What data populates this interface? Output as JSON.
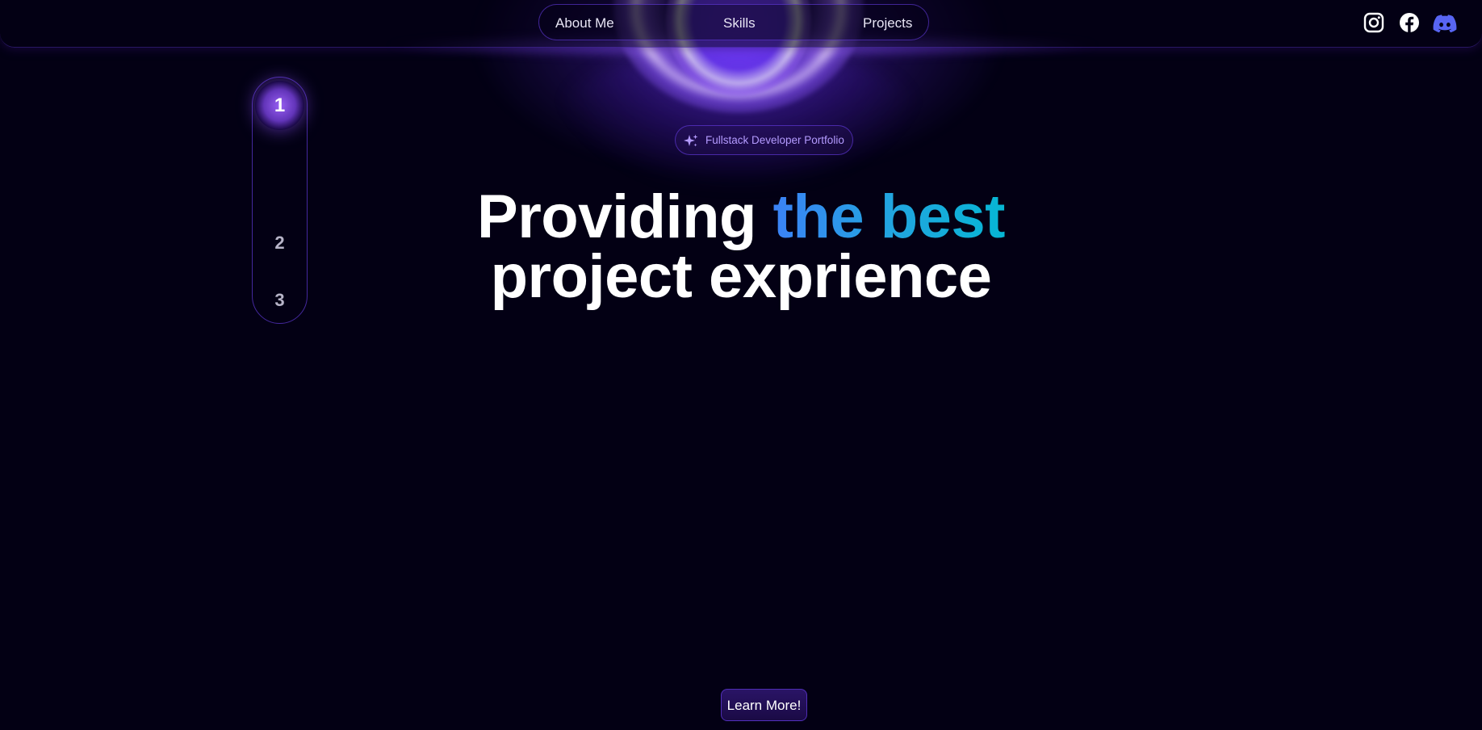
{
  "nav": {
    "links": [
      {
        "label": "About Me"
      },
      {
        "label": "Skills"
      },
      {
        "label": "Projects"
      }
    ]
  },
  "social": [
    {
      "icon": "instagram-icon"
    },
    {
      "icon": "facebook-icon"
    },
    {
      "icon": "discord-icon",
      "color": "#5865F2"
    }
  ],
  "stepper": {
    "steps": [
      "1",
      "2",
      "3"
    ],
    "active": "1"
  },
  "hero": {
    "badge": {
      "icon": "sparkles-icon",
      "text": "Fullstack Developer Portfolio"
    },
    "headline": {
      "line1_start": "Providing ",
      "line1_accent": "the best",
      "line2": "project exprience"
    },
    "cta_label": "Learn More!"
  },
  "colors": {
    "background": "#030014",
    "accent_purple": "#7042F8",
    "gradient_start": "#3B82F6",
    "gradient_end": "#06B6D4",
    "badge_text": "#B49BFF"
  }
}
